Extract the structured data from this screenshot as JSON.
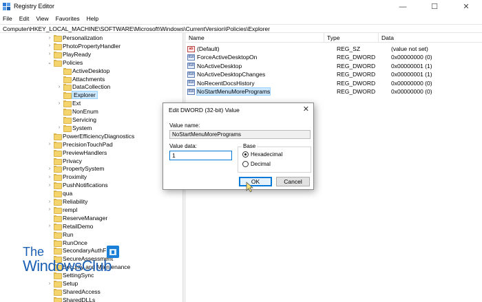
{
  "window": {
    "title": "Registry Editor",
    "icon": "registry-editor-icon",
    "controls": {
      "minimize": "—",
      "maximize": "☐",
      "close": "✕"
    }
  },
  "menubar": [
    "File",
    "Edit",
    "View",
    "Favorites",
    "Help"
  ],
  "address": "Computer\\HKEY_LOCAL_MACHINE\\SOFTWARE\\Microsoft\\Windows\\CurrentVersion\\Policies\\Explorer",
  "tree": [
    {
      "label": "Personalization",
      "chevron": "›",
      "selected": false
    },
    {
      "label": "PhotoPropertyHandler",
      "chevron": "›",
      "selected": false
    },
    {
      "label": "PlayReady",
      "chevron": "›",
      "selected": false
    },
    {
      "label": "Policies",
      "chevron": "⌄",
      "selected": false
    },
    {
      "label": "ActiveDesktop",
      "chevron": "",
      "selected": false
    },
    {
      "label": "Attachments",
      "chevron": "",
      "selected": false
    },
    {
      "label": "DataCollection",
      "chevron": "›",
      "selected": false
    },
    {
      "label": "Explorer",
      "chevron": "",
      "selected": true
    },
    {
      "label": "Ext",
      "chevron": "›",
      "selected": false
    },
    {
      "label": "NonEnum",
      "chevron": "",
      "selected": false
    },
    {
      "label": "Servicing",
      "chevron": "",
      "selected": false
    },
    {
      "label": "System",
      "chevron": "›",
      "selected": false
    },
    {
      "label": "PowerEfficiencyDiagnostics",
      "chevron": "",
      "selected": false
    },
    {
      "label": "PrecisionTouchPad",
      "chevron": "›",
      "selected": false
    },
    {
      "label": "PreviewHandlers",
      "chevron": "",
      "selected": false
    },
    {
      "label": "Privacy",
      "chevron": "",
      "selected": false
    },
    {
      "label": "PropertySystem",
      "chevron": "›",
      "selected": false
    },
    {
      "label": "Proximity",
      "chevron": "›",
      "selected": false
    },
    {
      "label": "PushNotifications",
      "chevron": "›",
      "selected": false
    },
    {
      "label": "qua",
      "chevron": "",
      "selected": false
    },
    {
      "label": "Reliability",
      "chevron": "›",
      "selected": false
    },
    {
      "label": "rempl",
      "chevron": "›",
      "selected": false
    },
    {
      "label": "ReserveManager",
      "chevron": "",
      "selected": false
    },
    {
      "label": "RetailDemo",
      "chevron": "›",
      "selected": false
    },
    {
      "label": "Run",
      "chevron": "",
      "selected": false
    },
    {
      "label": "RunOnce",
      "chevron": "",
      "selected": false
    },
    {
      "label": "SecondaryAuthF",
      "chevron": "",
      "selected": false
    },
    {
      "label": "SecureAssessment",
      "chevron": "",
      "selected": false
    },
    {
      "label": "Security and Maintenance",
      "chevron": "",
      "selected": false
    },
    {
      "label": "SettingSync",
      "chevron": "",
      "selected": false
    },
    {
      "label": "Setup",
      "chevron": "›",
      "selected": false
    },
    {
      "label": "SharedAccess",
      "chevron": "",
      "selected": false
    },
    {
      "label": "SharedDLLs",
      "chevron": "",
      "selected": false
    }
  ],
  "list": {
    "headers": {
      "name": "Name",
      "type": "Type",
      "data": "Data"
    },
    "rows": [
      {
        "name": "(Default)",
        "type": "REG_SZ",
        "data": "(value not set)",
        "icon": "ab",
        "selected": false
      },
      {
        "name": "ForceActiveDesktopOn",
        "type": "REG_DWORD",
        "data": "0x00000000 (0)",
        "icon": "010",
        "selected": false
      },
      {
        "name": "NoActiveDesktop",
        "type": "REG_DWORD",
        "data": "0x00000001 (1)",
        "icon": "010",
        "selected": false
      },
      {
        "name": "NoActiveDesktopChanges",
        "type": "REG_DWORD",
        "data": "0x00000001 (1)",
        "icon": "010",
        "selected": false
      },
      {
        "name": "NoRecentDocsHistory",
        "type": "REG_DWORD",
        "data": "0x00000000 (0)",
        "icon": "010",
        "selected": false
      },
      {
        "name": "NoStartMenuMorePrograms",
        "type": "REG_DWORD",
        "data": "0x00000000 (0)",
        "icon": "010",
        "selected": true
      }
    ]
  },
  "dialog": {
    "title": "Edit DWORD (32-bit) Value",
    "close": "✕",
    "value_name_label": "Value name:",
    "value_name": "NoStartMenuMorePrograms",
    "value_data_label": "Value data:",
    "value_data": "1",
    "base_label": "Base",
    "radio_hex": "Hexadecimal",
    "radio_dec": "Decimal",
    "base_selected": "Hexadecimal",
    "ok": "OK",
    "cancel": "Cancel"
  },
  "watermark": {
    "line1": "The",
    "line2": "WindowsClub"
  },
  "colors": {
    "selection": "#cce8ff",
    "accent": "#0078d7",
    "folder": "#f4d46c",
    "watermark": "#1a5fb4"
  }
}
